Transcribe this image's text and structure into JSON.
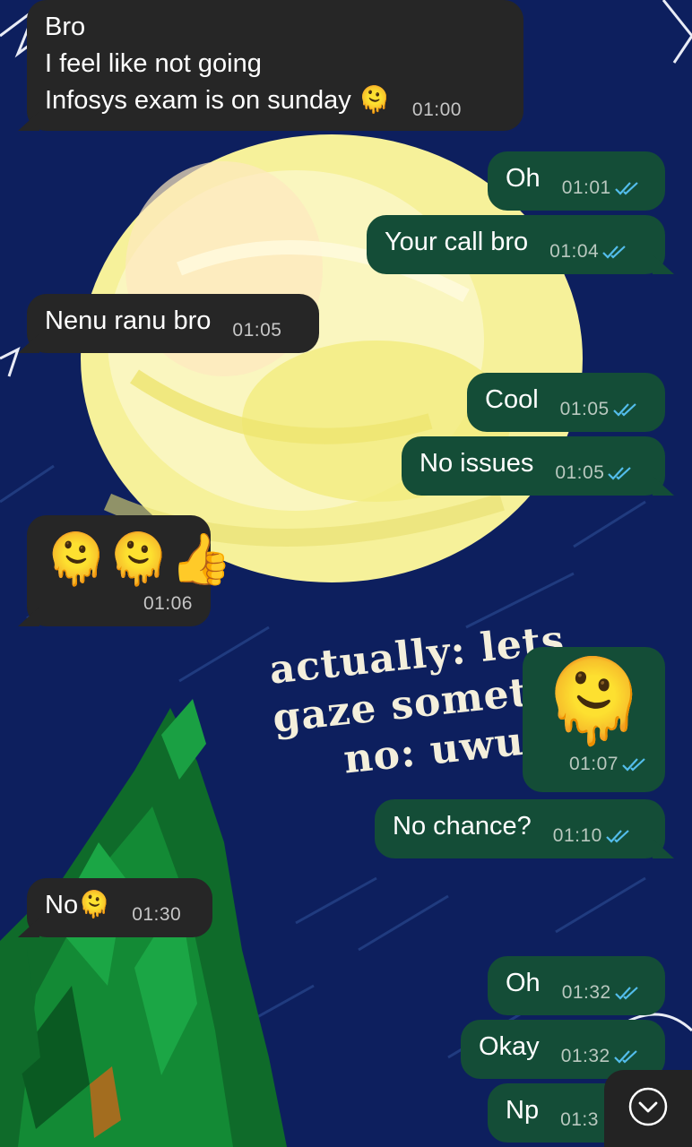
{
  "messages": [
    {
      "id": "m1",
      "dir": "in",
      "lines": [
        "Bro",
        "I feel like not going",
        "Infosys exam is on sunday 🫠"
      ],
      "time": "01:00"
    },
    {
      "id": "m2",
      "dir": "out",
      "text": "Oh",
      "time": "01:01",
      "status": "read"
    },
    {
      "id": "m3",
      "dir": "out",
      "text": "Your call bro",
      "time": "01:04",
      "status": "read"
    },
    {
      "id": "m4",
      "dir": "in",
      "text": "Nenu ranu bro",
      "time": "01:05"
    },
    {
      "id": "m5",
      "dir": "out",
      "text": "Cool",
      "time": "01:05",
      "status": "read"
    },
    {
      "id": "m6",
      "dir": "out",
      "text": "No issues",
      "time": "01:05",
      "status": "read"
    },
    {
      "id": "m7",
      "dir": "in",
      "text": "🫠🫠👍",
      "time": "01:06"
    },
    {
      "id": "m8",
      "dir": "out",
      "text": "🫠",
      "time": "01:07",
      "status": "read"
    },
    {
      "id": "m9",
      "dir": "out",
      "text": "No chance?",
      "time": "01:10",
      "status": "read"
    },
    {
      "id": "m10",
      "dir": "in",
      "text": "No🫠",
      "time": "01:30"
    },
    {
      "id": "m11",
      "dir": "out",
      "text": "Oh",
      "time": "01:32",
      "status": "read"
    },
    {
      "id": "m12",
      "dir": "out",
      "text": "Okay",
      "time": "01:32",
      "status": "read"
    },
    {
      "id": "m13",
      "dir": "out",
      "text": "Np",
      "time": "01:3",
      "status": "read"
    }
  ],
  "wallpaper_text": [
    "actually: lets",
    "gaze sometin",
    "no: uwu l"
  ],
  "scroll_button": {
    "icon": "chevron-down-icon"
  },
  "colors": {
    "incoming": "#262626",
    "outgoing": "#144d37",
    "read_tick": "#53bdeb",
    "background": "#0d1f5e"
  }
}
